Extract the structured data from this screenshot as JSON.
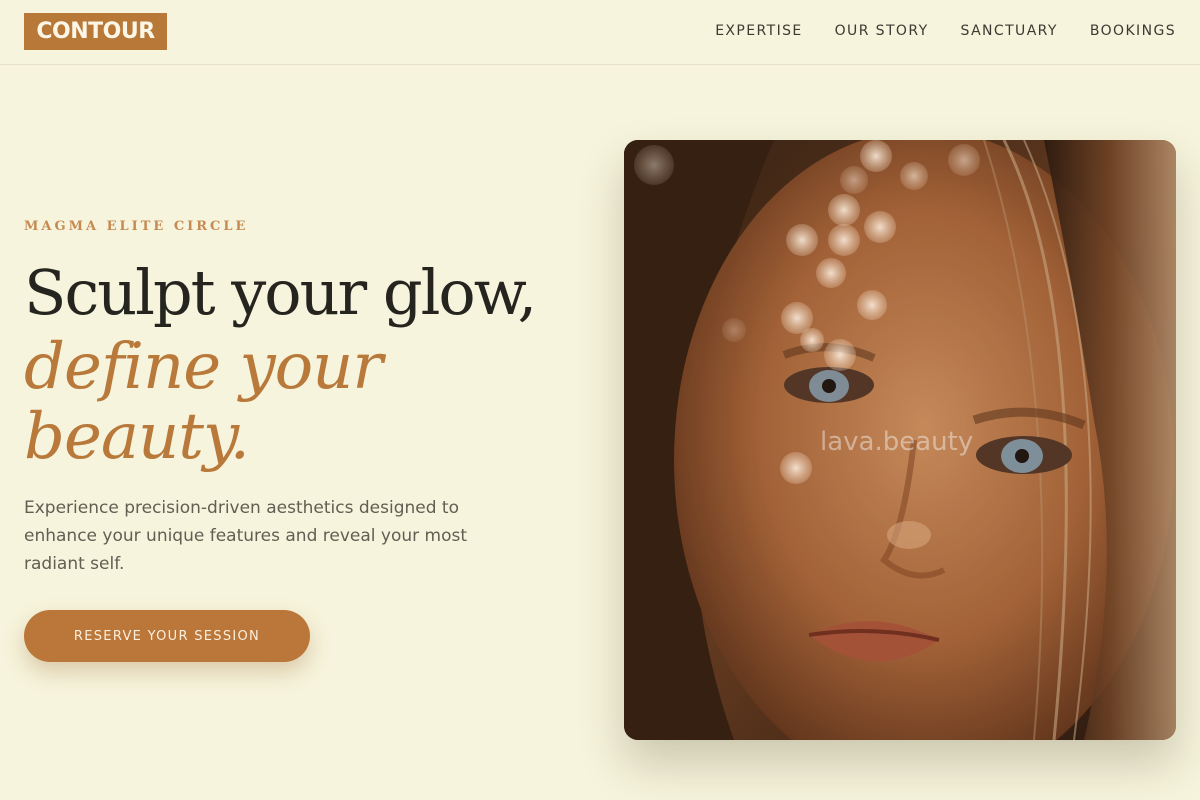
{
  "brand": {
    "logo": "CONTOUR"
  },
  "nav": {
    "items": [
      {
        "label": "EXPERTISE"
      },
      {
        "label": "OUR STORY"
      },
      {
        "label": "SANCTUARY"
      },
      {
        "label": "BOOKINGS"
      }
    ]
  },
  "hero": {
    "eyebrow": "MAGMA ELITE CIRCLE",
    "headline_line1": "Sculpt your glow,",
    "headline_line2": "define your",
    "headline_line3": "beauty.",
    "lead": "Experience precision-driven aesthetics designed to enhance your unique features and reveal your most radiant self.",
    "cta_label": "RESERVE YOUR SESSION",
    "image_watermark": "lava.beauty"
  },
  "colors": {
    "background": "#f6f4dc",
    "accent": "#bb763a",
    "text_dark": "#26241f"
  }
}
